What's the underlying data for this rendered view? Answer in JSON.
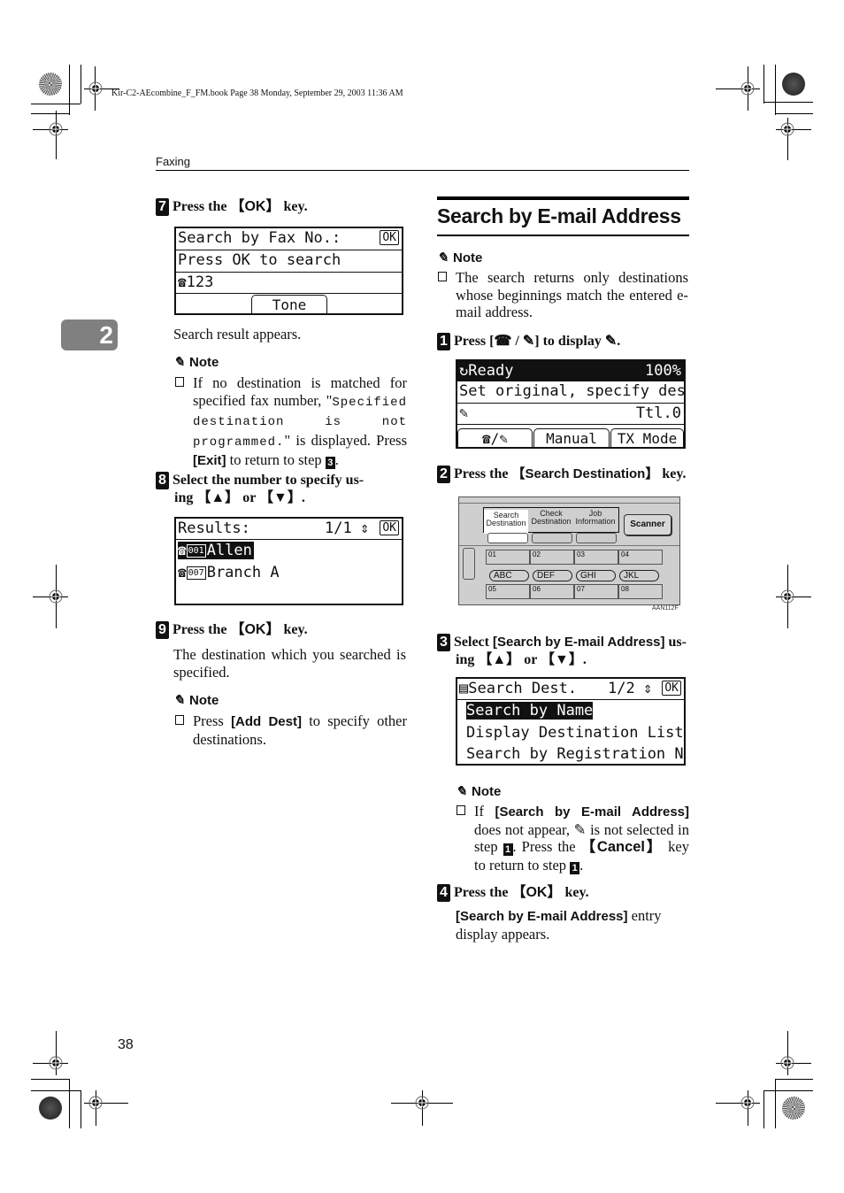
{
  "header": {
    "file_meta": "Kir-C2-AEcombine_F_FM.book  Page 38  Monday, September 29, 2003  11:36 AM",
    "section": "Faxing",
    "chapter_tab": "2",
    "page_number": "38"
  },
  "left": {
    "step7": {
      "num": "7",
      "pre": "Press the ",
      "key": "【OK】",
      "post": " key.",
      "lcd": {
        "title": "Search by Fax No.:",
        "ok": "OK",
        "line2": "Press OK to search",
        "tel_icon": "☎",
        "number": "123",
        "button": "Tone"
      },
      "result": "Search result appears.",
      "note_label": "Note",
      "note": {
        "t1": "If no destination is matched for specified fax number, \"",
        "mono": "Specified destination is not programmed.",
        "t2": "\" is displayed. Press ",
        "key": "[Exit]",
        "t3": " to return to step ",
        "step_ref": "3",
        "t4": "."
      }
    },
    "step8": {
      "num": "8",
      "line1": "Select the number to specify us-",
      "line2_pre": "ing ",
      "up": "【▲】",
      "or": " or ",
      "down": "【▼】",
      "end": ".",
      "lcd": {
        "title": "Results:",
        "page": "1/1",
        "arrows": "⇕",
        "ok": "OK",
        "items": [
          {
            "icon": "☎",
            "code": "001",
            "name": "Allen",
            "selected": true
          },
          {
            "icon": "☎",
            "code": "007",
            "name": "Branch A",
            "selected": false
          }
        ]
      }
    },
    "step9": {
      "num": "9",
      "pre": "Press the ",
      "key": "【OK】",
      "post": " key.",
      "text": "The destination which you searched is specified.",
      "note_label": "Note",
      "note": {
        "t1": "Press ",
        "key": "[Add Dest]",
        "t2": " to specify other destinations."
      }
    }
  },
  "right": {
    "title": "Search by E-mail Address",
    "intro_note_label": "Note",
    "intro_note": "The search returns only destinations whose beginnings match the entered e-mail address.",
    "step1": {
      "num": "1",
      "pre": "Press [",
      "tel": "☎",
      "slash": " / ",
      "email": "✎",
      "mid": "] to display ",
      "end": ".",
      "lcd": {
        "status": "Ready",
        "zoom": "100%",
        "line2": "Set original, specify dest.",
        "total": "Ttl.0",
        "buttons": [
          "☎/✎",
          "Manual",
          "TX Mode"
        ]
      }
    },
    "step2": {
      "num": "2",
      "pre": "Press the ",
      "key": "【Search Destination】",
      "post": " key.",
      "panel": {
        "tabs": [
          "Search\nDestination",
          "Check\nDestination",
          "Job\nInformation"
        ],
        "scanner": "Scanner",
        "onetouch_top": [
          "01",
          "02",
          "03",
          "04"
        ],
        "alpha": [
          "ABC",
          "DEF",
          "GHI",
          "JKL"
        ],
        "onetouch_bottom": [
          "05",
          "06",
          "07",
          "08"
        ],
        "code": "AAN112F"
      }
    },
    "step3": {
      "num": "3",
      "pre": "Select ",
      "key": "[Search by E-mail Address]",
      "post": " us-",
      "line2_pre": "ing ",
      "up": "【▲】",
      "or": " or ",
      "down": "【▼】",
      "end": ".",
      "lcd": {
        "title": "Search Dest.",
        "page": "1/2",
        "arrows": "⇕",
        "ok": "OK",
        "items": [
          "Search by Name",
          "Display Destination List",
          "Search by Registration No."
        ]
      },
      "note_label": "Note",
      "note": {
        "t1": "If ",
        "key": "[Search by E-mail Address]",
        "t2": " does not appear, ",
        "t3": " is not selected in step ",
        "ref1": "1",
        "t4": ". Press the ",
        "key2": "【Cancel】",
        "t5": " key to return to step ",
        "ref2": "1",
        "t6": "."
      }
    },
    "step4": {
      "num": "4",
      "pre": "Press the ",
      "key": "【OK】",
      "post": " key.",
      "key2": "[Search by E-mail Address]",
      "text": " entry display appears."
    }
  }
}
